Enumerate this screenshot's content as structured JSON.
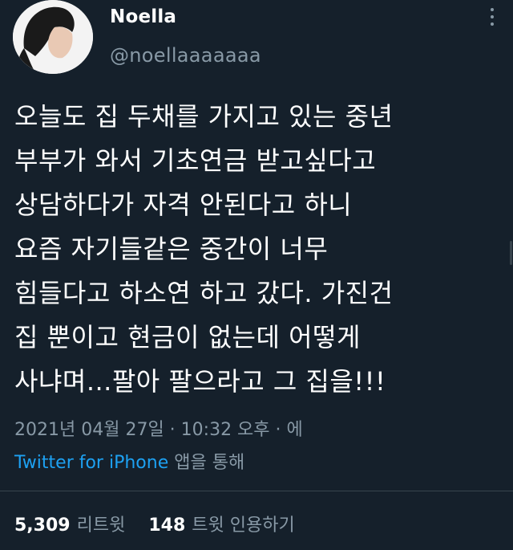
{
  "user": {
    "name": "Noella",
    "handle": "@noellaaaaaaa"
  },
  "tweet": {
    "lines": [
      "오늘도 집 두채를 가지고 있는 중년",
      "부부가 와서 기초연금 받고싶다고",
      "상담하다가 자격 안된다고 하니",
      "요즘 자기들같은 중간이 너무",
      "힘들다고 하소연 하고 갔다. 가진건",
      "집 뿐이고 현금이 없는데 어떻게",
      "사냐며...팔아 팔으라고 그 집을!!!"
    ]
  },
  "meta": {
    "timestamp": "2021년 04월 27일 · 10:32 오후 · 에",
    "source_link": "Twitter for iPhone",
    "source_suffix": " 앱을 통해"
  },
  "stats": {
    "retweets_count": "5,309",
    "retweets_label": "리트윗",
    "quotes_count": "148",
    "quotes_label": "트윗 인용하기"
  },
  "colors": {
    "background": "#15202b",
    "text": "#ffffff",
    "muted": "#8899a6",
    "accent": "#1da1f2",
    "divider": "#38444d"
  }
}
